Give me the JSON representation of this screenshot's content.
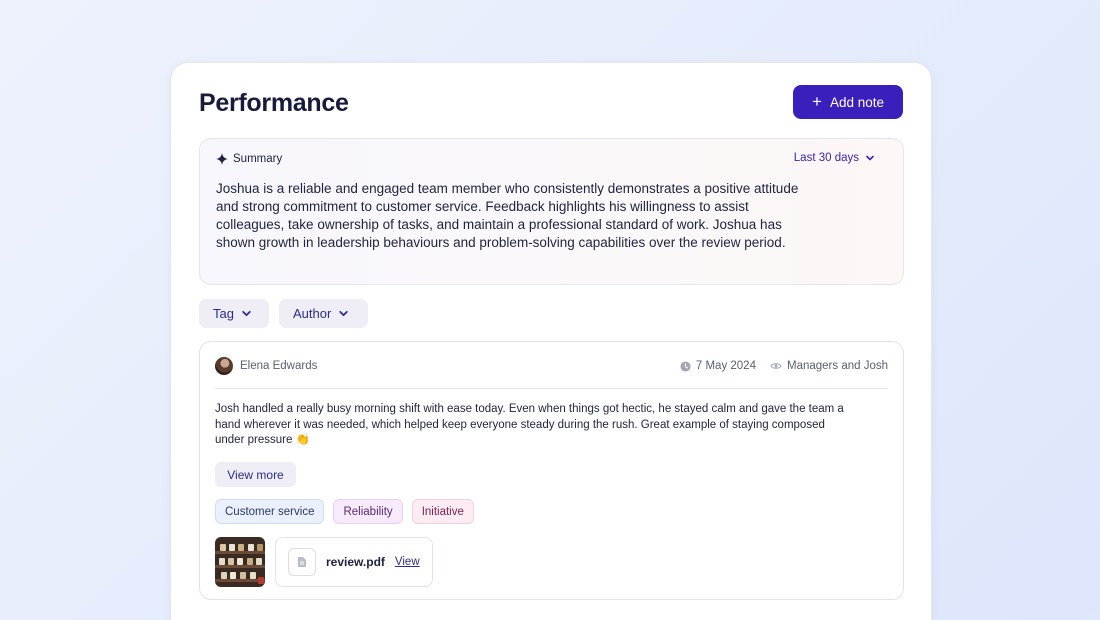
{
  "header": {
    "title": "Performance",
    "add_note_label": "Add note"
  },
  "summary": {
    "heading": "Summary",
    "range": "Last 30 days",
    "text": "Joshua is a reliable and engaged team member who consistently demonstrates a positive attitude and strong commitment to customer service. Feedback highlights his willingness to assist colleagues, take ownership of tasks, and maintain a professional standard of work. Joshua has shown growth in leadership behaviours and problem-solving capabilities over the review period."
  },
  "filters": {
    "tag_label": "Tag",
    "author_label": "Author"
  },
  "note": {
    "author": "Elena Edwards",
    "date": "7 May 2024",
    "visibility": "Managers and Josh",
    "text": "Josh handled a really busy morning shift with ease today. Even when things got hectic, he stayed calm and gave the team a hand wherever it was needed, which helped keep everyone steady during the rush. Great example of staying composed under pressure 👏",
    "view_more_label": "View more",
    "tags": [
      {
        "label": "Customer service",
        "bg": "#eaf1fd",
        "border": "#cfdcf7",
        "color": "#2a3a6a"
      },
      {
        "label": "Reliability",
        "bg": "#f7ebfb",
        "border": "#ead0f5",
        "color": "#5a2a78"
      },
      {
        "label": "Initiative",
        "bg": "#fdecf4",
        "border": "#f5cfe2",
        "color": "#7a2450"
      }
    ],
    "attachment": {
      "file_name": "review.pdf",
      "view_label": "View"
    }
  },
  "colors": {
    "accent": "#3a1fbd",
    "title": "#171a3b"
  }
}
